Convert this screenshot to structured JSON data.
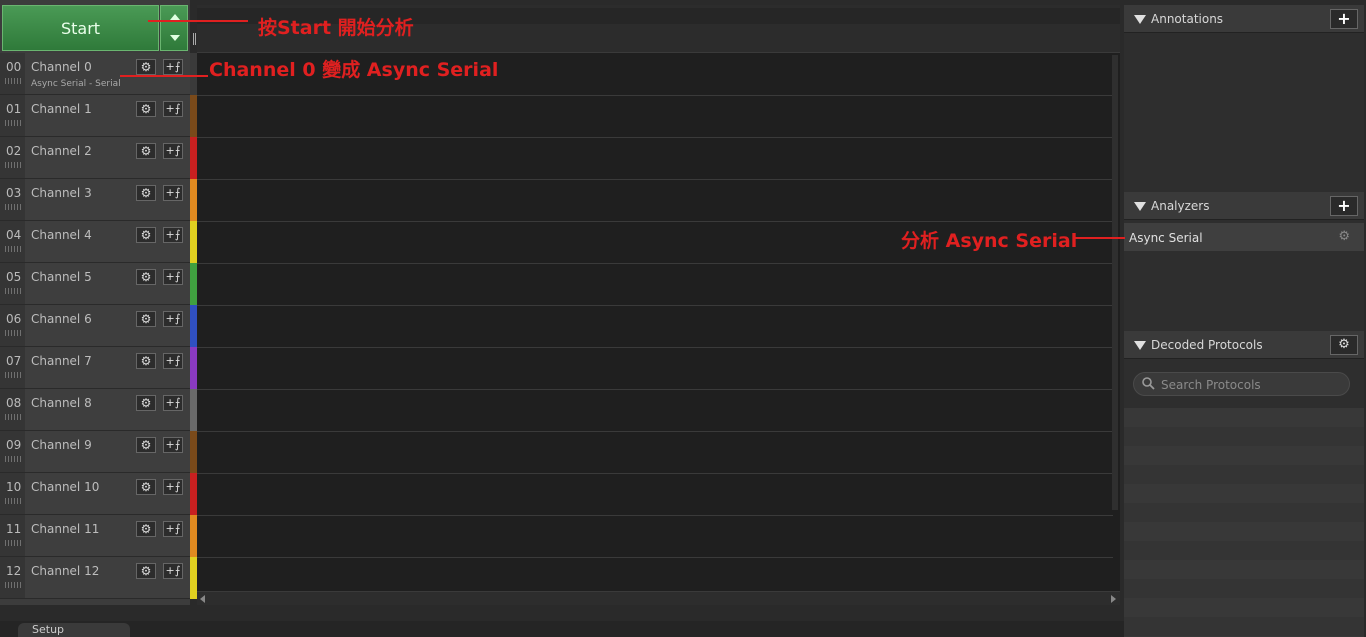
{
  "start_button": {
    "label": "Start"
  },
  "channels": [
    {
      "num": "00",
      "name": "Channel 0",
      "sub": "Async Serial - Serial",
      "color": "#3a3a3a"
    },
    {
      "num": "01",
      "name": "Channel 1",
      "color": "#7a4a1a"
    },
    {
      "num": "02",
      "name": "Channel 2",
      "color": "#c82020"
    },
    {
      "num": "03",
      "name": "Channel 3",
      "color": "#e08a20"
    },
    {
      "num": "04",
      "name": "Channel 4",
      "color": "#e0d020"
    },
    {
      "num": "05",
      "name": "Channel 5",
      "color": "#40a040"
    },
    {
      "num": "06",
      "name": "Channel 6",
      "color": "#3050c0"
    },
    {
      "num": "07",
      "name": "Channel 7",
      "color": "#8a3ac0"
    },
    {
      "num": "08",
      "name": "Channel 8",
      "color": "#6a6a6a"
    },
    {
      "num": "09",
      "name": "Channel 9",
      "color": "#7a4a1a"
    },
    {
      "num": "10",
      "name": "Channel 10",
      "color": "#c82020"
    },
    {
      "num": "11",
      "name": "Channel 11",
      "color": "#e08a20"
    },
    {
      "num": "12",
      "name": "Channel 12",
      "color": "#e0d020"
    }
  ],
  "right_panel": {
    "annotations": {
      "title": "Annotations"
    },
    "analyzers": {
      "title": "Analyzers",
      "items": [
        {
          "label": "Async Serial"
        }
      ]
    },
    "decoded_protocols": {
      "title": "Decoded Protocols",
      "search_placeholder": "Search Protocols"
    }
  },
  "bottom": {
    "tab_label": "Setup"
  },
  "annotations_overlay": {
    "start_note": "按Start 開始分析",
    "channel_note": "Channel 0 變成 Async Serial",
    "analyzer_note": "分析 Async Serial"
  },
  "icons": {
    "gear": "gear-icon",
    "trigger": "trigger-icon",
    "plus": "plus-icon",
    "search": "search-icon",
    "collapse": "triangle-down-icon"
  },
  "colors": {
    "start_green": "#3a8a45",
    "annotation_red": "#e02020"
  }
}
